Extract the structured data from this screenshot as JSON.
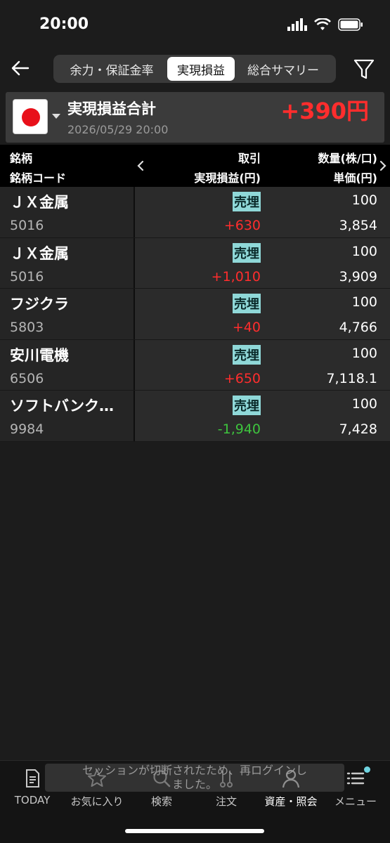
{
  "status_bar": {
    "time": "20:00",
    "icons": [
      "signal-icon",
      "wifi-icon",
      "battery-icon"
    ]
  },
  "nav": {
    "back_icon": "arrow-left-icon",
    "tabs": [
      {
        "label": "余力・保証金率",
        "selected": false
      },
      {
        "label": "実現損益",
        "selected": true
      },
      {
        "label": "総合サマリー",
        "selected": false
      }
    ],
    "filter_icon": "filter-icon"
  },
  "summary": {
    "flag": "japan-flag-icon",
    "title": "実現損益合計",
    "timestamp": "2026/05/29 20:00",
    "total": "+390円"
  },
  "table": {
    "headers": {
      "name": "銘柄",
      "code": "銘柄コード",
      "trade": "取引",
      "realized_pl": "実現損益(円)",
      "quantity": "数量(株/口)",
      "unit_price": "単価(円)"
    },
    "rows": [
      {
        "name": "ＪＸ金属",
        "code": "5016",
        "trade": "売埋",
        "pl": "+630",
        "pl_sign": "positive",
        "qty": "100",
        "price": "3,854"
      },
      {
        "name": "ＪＸ金属",
        "code": "5016",
        "trade": "売埋",
        "pl": "+1,010",
        "pl_sign": "positive",
        "qty": "100",
        "price": "3,909"
      },
      {
        "name": "フジクラ",
        "code": "5803",
        "trade": "売埋",
        "pl": "+40",
        "pl_sign": "positive",
        "qty": "100",
        "price": "4,766"
      },
      {
        "name": "安川電機",
        "code": "6506",
        "trade": "売埋",
        "pl": "+650",
        "pl_sign": "positive",
        "qty": "100",
        "price": "7,118.1"
      },
      {
        "name": "ソフトバンク…",
        "code": "9984",
        "trade": "売埋",
        "pl": "-1,940",
        "pl_sign": "negative",
        "qty": "100",
        "price": "7,428"
      }
    ]
  },
  "colors": {
    "positive": "#ff2d2d",
    "negative": "#3ec43e",
    "badge": "#8fd8d8",
    "accent_dot": "#6fd3e0"
  },
  "toast": {
    "line1": "セッションが切断されたため、再ログインし",
    "line2": "ました。"
  },
  "tabbar": [
    {
      "label": "TODAY",
      "icon": "document-icon",
      "active": false
    },
    {
      "label": "お気に入り",
      "icon": "star-icon",
      "active": false
    },
    {
      "label": "検索",
      "icon": "search-icon",
      "active": false
    },
    {
      "label": "注文",
      "icon": "order-icon",
      "active": false
    },
    {
      "label": "資産・照会",
      "icon": "person-icon",
      "active": true
    },
    {
      "label": "メニュー",
      "icon": "menu-icon",
      "active": false
    }
  ]
}
